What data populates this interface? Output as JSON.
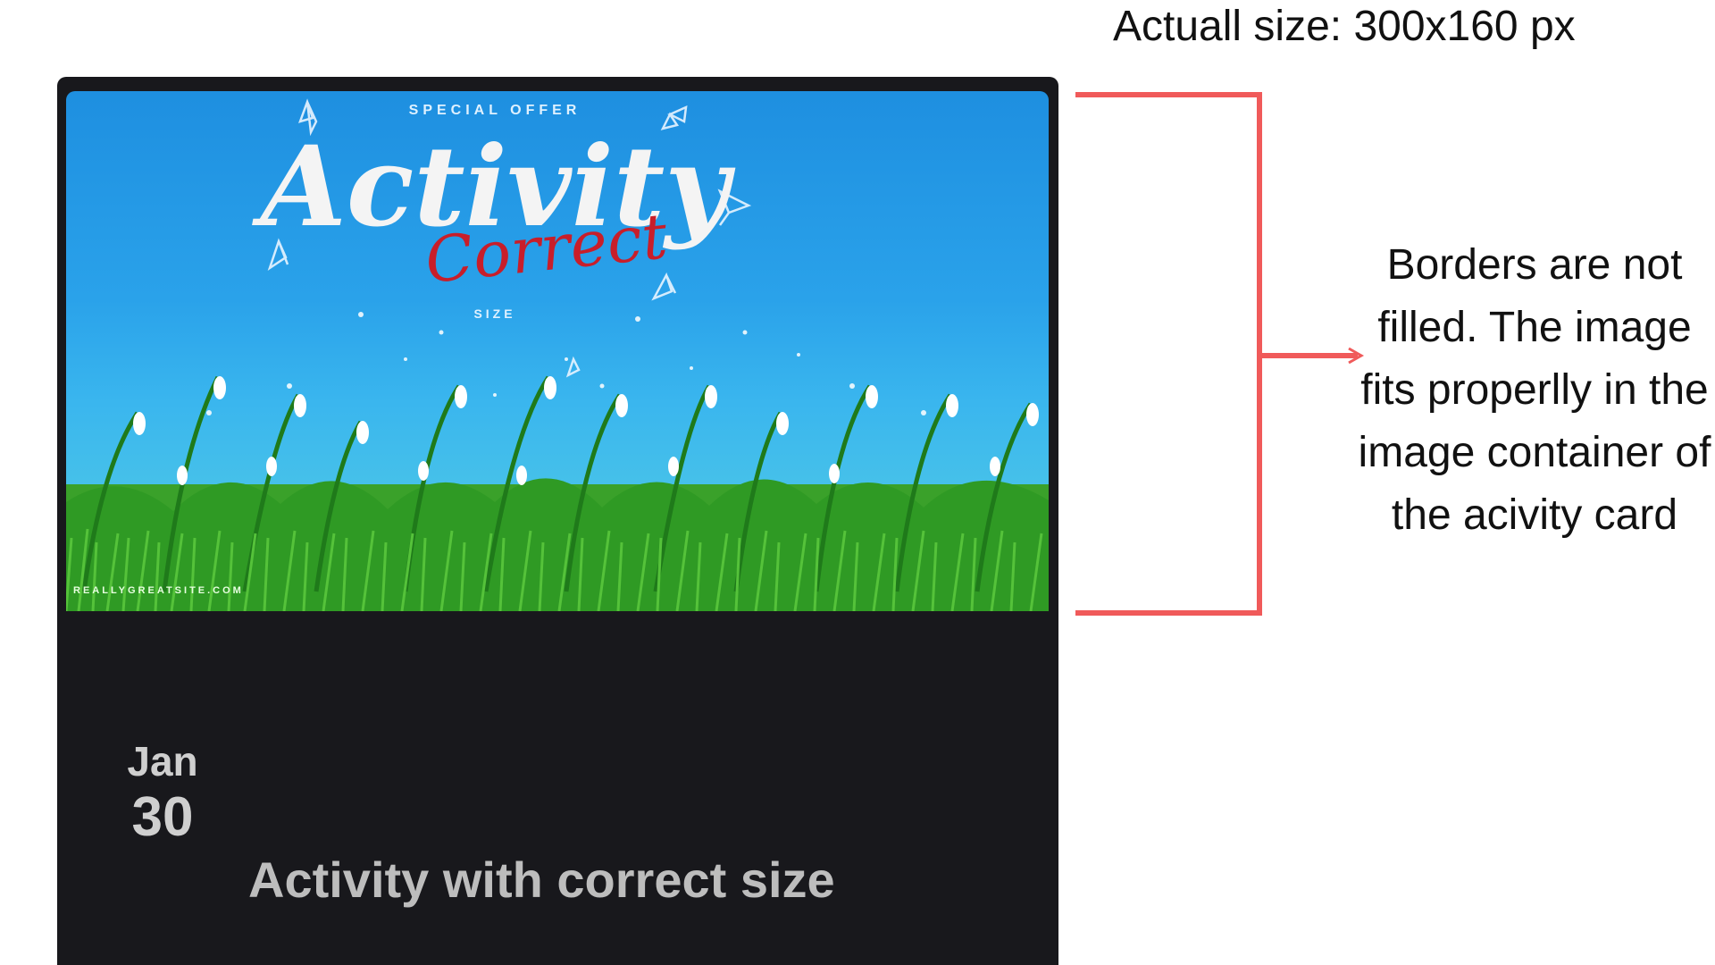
{
  "annotation": {
    "size_note": "Actuall size: 300x160 px",
    "explanation": "Borders are not filled. The image fits properlly in the image container of the acivity card",
    "accent_color": "#f05a5a"
  },
  "card": {
    "image": {
      "kicker": "SPECIAL OFFER",
      "headline": "Activity",
      "script_word": "Correct",
      "subline": "SIZE",
      "footer_url": "REALLYGREATSITE.COM"
    },
    "date": {
      "month": "Jan",
      "day": "30"
    },
    "title": "Activity with correct size"
  }
}
